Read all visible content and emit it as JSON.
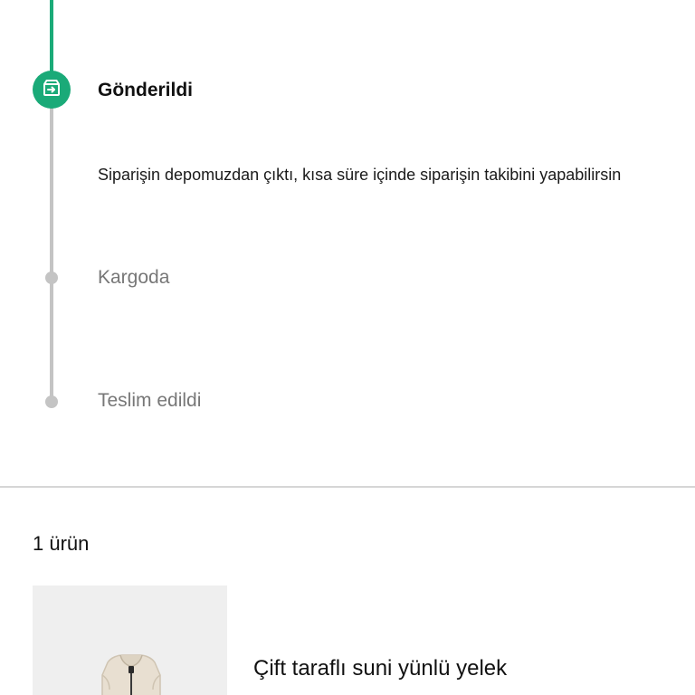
{
  "timeline": {
    "accent_color": "#1aaa78",
    "inactive_color": "#c4c4c4",
    "steps": [
      {
        "title": "Gönderildi",
        "status": "active",
        "icon": "package-icon",
        "description": "Siparişin depomuzdan çıktı, kısa süre içinde siparişin takibini yapabilirsin"
      },
      {
        "title": "Kargoda",
        "status": "pending"
      },
      {
        "title": "Teslim edildi",
        "status": "pending"
      }
    ]
  },
  "order_items": {
    "count_label": "1 ürün",
    "items": [
      {
        "name": "Çift taraflı suni yünlü yelek",
        "thumbnail": "vest-image"
      }
    ]
  }
}
